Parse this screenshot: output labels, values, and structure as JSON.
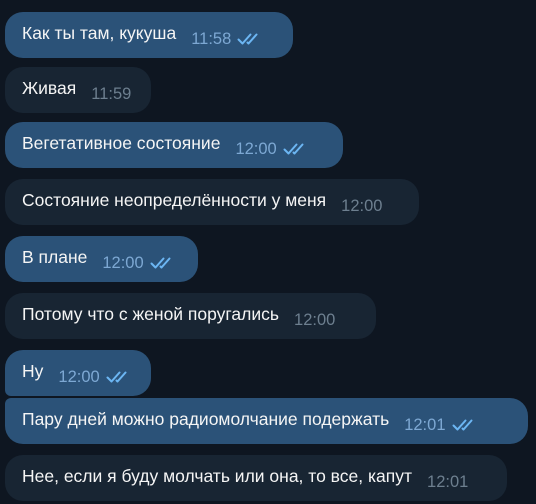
{
  "colors": {
    "background": "#0e1621",
    "outgoing_bubble": "#2b5278",
    "incoming_bubble": "#182533",
    "message_text": "#f5f5f5",
    "outgoing_time": "#7da8d3",
    "incoming_time": "#6d7f8f",
    "read_checks": "#6cb6f3"
  },
  "messages": [
    {
      "direction": "outgoing",
      "text": "Как ты там, кукуша",
      "time": "11:58",
      "status": "read",
      "status_icon": "double-check-icon"
    },
    {
      "direction": "incoming",
      "text": "Живая",
      "time": "11:59"
    },
    {
      "direction": "outgoing",
      "text": "Вегетативное состояние",
      "time": "12:00",
      "status": "read",
      "status_icon": "double-check-icon"
    },
    {
      "direction": "incoming",
      "text": "Состояние неопределённости у меня",
      "time": "12:00"
    },
    {
      "direction": "outgoing",
      "text": "В плане",
      "time": "12:00",
      "status": "read",
      "status_icon": "double-check-icon"
    },
    {
      "direction": "incoming",
      "text": "Потому что с женой поругались",
      "time": "12:00"
    },
    {
      "direction": "outgoing",
      "text": "Ну",
      "time": "12:00",
      "status": "read",
      "status_icon": "double-check-icon"
    },
    {
      "direction": "outgoing",
      "text": "Пару дней можно радиомолчание подержать",
      "time": "12:01",
      "status": "read",
      "status_icon": "double-check-icon"
    },
    {
      "direction": "incoming",
      "text": "Нее, если я буду молчать или она, то все, капут",
      "time": "12:01"
    }
  ]
}
